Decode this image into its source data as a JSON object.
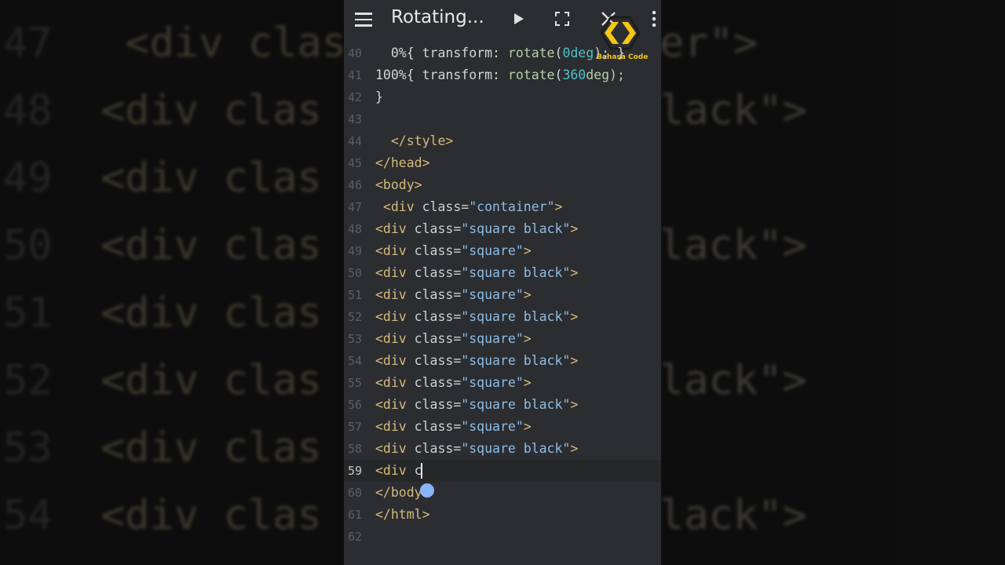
{
  "toolbar": {
    "title": "Rotating...",
    "menu_icon": "hamburger-menu-icon",
    "run_icon": "play-icon",
    "fullscreen_icon": "fullscreen-icon",
    "close_icon": "close-icon",
    "more_icon": "more-vertical-icon"
  },
  "logo": {
    "text": "Bahasa Code",
    "color": "#f5c518"
  },
  "background_zoom": {
    "rows": [
      {
        "num": "47",
        "text": "<div class=\"container\">"
      },
      {
        "num": "48",
        "text": "<div class=\"square black\">"
      },
      {
        "num": "49",
        "text": "<div class=\"square\">"
      },
      {
        "num": "50",
        "text": "<div class=\"square black\">"
      },
      {
        "num": "51",
        "text": "<div class=\"square\">"
      },
      {
        "num": "52",
        "text": "<div class=\"square black\">"
      },
      {
        "num": "53",
        "text": "<div class=\"square\">"
      },
      {
        "num": "54",
        "text": "<div class=\"square black\">"
      }
    ],
    "left_texts": [
      " <div clas",
      "<div clas",
      "<div clas",
      "<div clas",
      "<div clas",
      "<div clas",
      "<div clas",
      "<div clas"
    ],
    "right_texts": [
      "er\">",
      "lack\">",
      "",
      "lack\">",
      "",
      "lack\">",
      "",
      "lack\">"
    ]
  },
  "editor": {
    "active_line": "59",
    "lines": [
      {
        "n": "40",
        "segs": [
          {
            "t": "  0%{ transform: ",
            "c": "plain"
          },
          {
            "t": "rotate",
            "c": "kw"
          },
          {
            "t": "(",
            "c": "plain"
          },
          {
            "t": "0deg",
            "c": "num"
          },
          {
            "t": "); }",
            "c": "plain"
          }
        ]
      },
      {
        "n": "41",
        "segs": [
          {
            "t": "100%{ transform: ",
            "c": "plain"
          },
          {
            "t": "rotate",
            "c": "kw"
          },
          {
            "t": "(",
            "c": "plain"
          },
          {
            "t": "360",
            "c": "num"
          },
          {
            "t": "deg);",
            "c": "kw"
          }
        ]
      },
      {
        "n": "42",
        "segs": [
          {
            "t": "}",
            "c": "plain"
          }
        ]
      },
      {
        "n": "43",
        "segs": []
      },
      {
        "n": "44",
        "segs": [
          {
            "t": "  </style>",
            "c": "tag"
          }
        ]
      },
      {
        "n": "45",
        "segs": [
          {
            "t": "</head>",
            "c": "tag"
          }
        ]
      },
      {
        "n": "46",
        "segs": [
          {
            "t": "<body>",
            "c": "tag"
          }
        ]
      },
      {
        "n": "47",
        "segs": [
          {
            "t": " <div ",
            "c": "tag"
          },
          {
            "t": "class=",
            "c": "attr"
          },
          {
            "t": "\"container\"",
            "c": "str"
          },
          {
            "t": ">",
            "c": "tag"
          }
        ]
      },
      {
        "n": "48",
        "segs": [
          {
            "t": "<div ",
            "c": "tag"
          },
          {
            "t": "class=",
            "c": "attr"
          },
          {
            "t": "\"square black\"",
            "c": "str"
          },
          {
            "t": ">",
            "c": "tag"
          }
        ]
      },
      {
        "n": "49",
        "segs": [
          {
            "t": "<div ",
            "c": "tag"
          },
          {
            "t": "class=",
            "c": "attr"
          },
          {
            "t": "\"square\"",
            "c": "str"
          },
          {
            "t": ">",
            "c": "tag"
          }
        ]
      },
      {
        "n": "50",
        "segs": [
          {
            "t": "<div ",
            "c": "tag"
          },
          {
            "t": "class=",
            "c": "attr"
          },
          {
            "t": "\"square black\"",
            "c": "str"
          },
          {
            "t": ">",
            "c": "tag"
          }
        ]
      },
      {
        "n": "51",
        "segs": [
          {
            "t": "<div ",
            "c": "tag"
          },
          {
            "t": "class=",
            "c": "attr"
          },
          {
            "t": "\"square\"",
            "c": "str"
          },
          {
            "t": ">",
            "c": "tag"
          }
        ]
      },
      {
        "n": "52",
        "segs": [
          {
            "t": "<div ",
            "c": "tag"
          },
          {
            "t": "class=",
            "c": "attr"
          },
          {
            "t": "\"square black\"",
            "c": "str"
          },
          {
            "t": ">",
            "c": "tag"
          }
        ]
      },
      {
        "n": "53",
        "segs": [
          {
            "t": "<div ",
            "c": "tag"
          },
          {
            "t": "class=",
            "c": "attr"
          },
          {
            "t": "\"square\"",
            "c": "str"
          },
          {
            "t": ">",
            "c": "tag"
          }
        ]
      },
      {
        "n": "54",
        "segs": [
          {
            "t": "<div ",
            "c": "tag"
          },
          {
            "t": "class=",
            "c": "attr"
          },
          {
            "t": "\"square black\"",
            "c": "str"
          },
          {
            "t": ">",
            "c": "tag"
          }
        ]
      },
      {
        "n": "55",
        "segs": [
          {
            "t": "<div ",
            "c": "tag"
          },
          {
            "t": "class=",
            "c": "attr"
          },
          {
            "t": "\"square\"",
            "c": "str"
          },
          {
            "t": ">",
            "c": "tag"
          }
        ]
      },
      {
        "n": "56",
        "segs": [
          {
            "t": "<div ",
            "c": "tag"
          },
          {
            "t": "class=",
            "c": "attr"
          },
          {
            "t": "\"square black\"",
            "c": "str"
          },
          {
            "t": ">",
            "c": "tag"
          }
        ]
      },
      {
        "n": "57",
        "segs": [
          {
            "t": "<div ",
            "c": "tag"
          },
          {
            "t": "class=",
            "c": "attr"
          },
          {
            "t": "\"square\"",
            "c": "str"
          },
          {
            "t": ">",
            "c": "tag"
          }
        ]
      },
      {
        "n": "58",
        "segs": [
          {
            "t": "<div ",
            "c": "tag"
          },
          {
            "t": "class=",
            "c": "attr"
          },
          {
            "t": "\"square black\"",
            "c": "str"
          },
          {
            "t": ">",
            "c": "tag"
          }
        ]
      },
      {
        "n": "59",
        "segs": [
          {
            "t": "<div ",
            "c": "tag"
          },
          {
            "t": "c",
            "c": "attr"
          }
        ]
      },
      {
        "n": "60",
        "segs": [
          {
            "t": "</body>",
            "c": "tag"
          }
        ]
      },
      {
        "n": "61",
        "segs": [
          {
            "t": "</html>",
            "c": "tag"
          }
        ]
      },
      {
        "n": "62",
        "segs": []
      }
    ]
  }
}
